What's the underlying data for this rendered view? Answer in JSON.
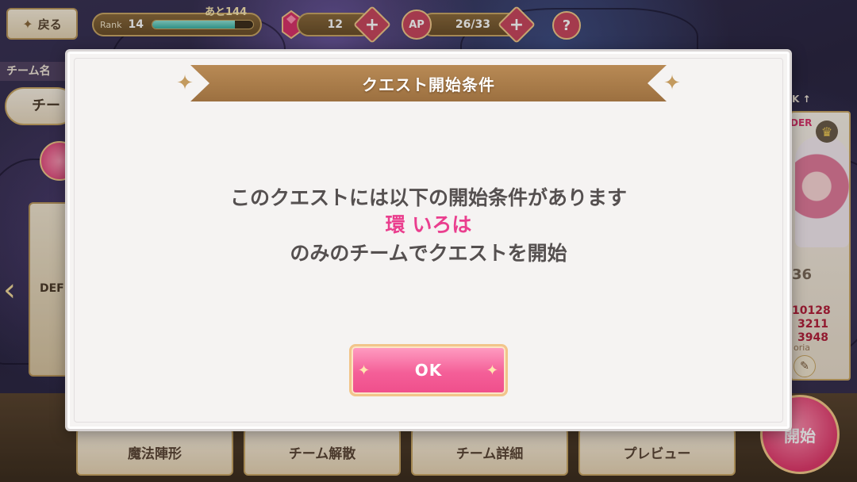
{
  "topbar": {
    "back_label": "戻る",
    "rank_label": "Rank",
    "rank_value": "14",
    "rank_next": "あと144",
    "rank_progress": 0.82,
    "gems": "12",
    "ap_label": "AP",
    "ap_value": "26/33",
    "help_label": "?"
  },
  "left": {
    "team_name_label": "チーム名",
    "team_name_value": "チー",
    "panel_label": "DEF"
  },
  "right": {
    "rank_text": "K ↑",
    "leader_text": "DER",
    "level": "36",
    "stats": [
      "10128",
      "3211",
      "3948"
    ],
    "name_fragment": "oria",
    "start_label": "開始"
  },
  "bottom_buttons": [
    "魔法陣形",
    "チーム解散",
    "チーム詳細",
    "プレビュー"
  ],
  "dialog": {
    "title": "クエスト開始条件",
    "line1": "このクエストには以下の開始条件があります",
    "highlight": "環 いろは",
    "line3": "のみのチームでクエストを開始",
    "ok_label": "OK"
  },
  "colors": {
    "highlight": "#ea3e8e",
    "banner": "#a87a46",
    "ok_button": "#f45f98"
  }
}
